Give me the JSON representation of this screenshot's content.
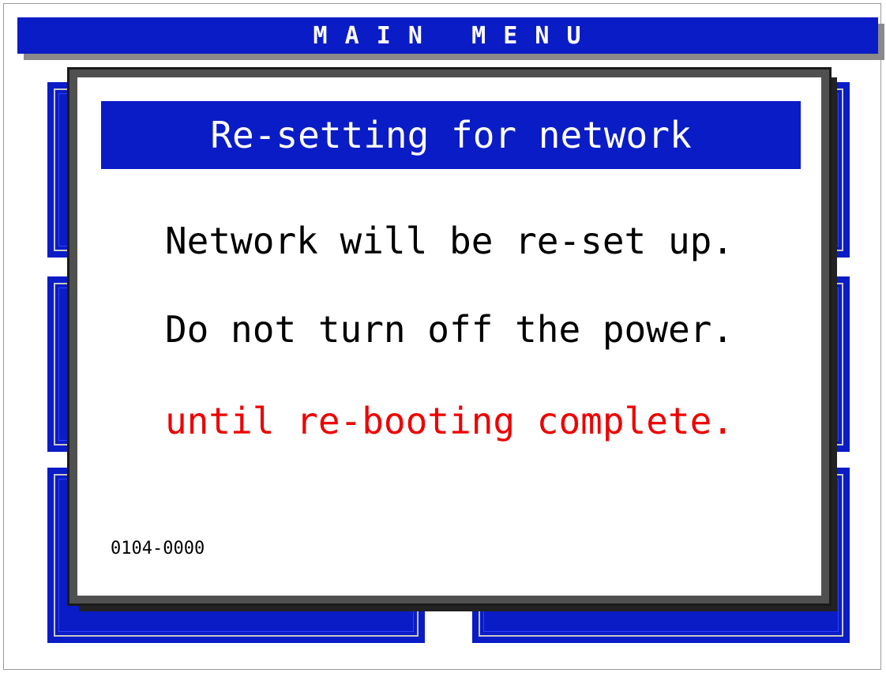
{
  "header": {
    "title": "M A I N   M E N U"
  },
  "dialog": {
    "title": "Re-setting for network",
    "line1": "Network will be re-set up.",
    "line2": "Do not turn off the power.",
    "line3": "until re-booting complete.",
    "code": "0104-0000"
  },
  "colors": {
    "title_bar": "#0a1cc6",
    "warning_text": "#ee0000",
    "body_text": "#000000"
  }
}
